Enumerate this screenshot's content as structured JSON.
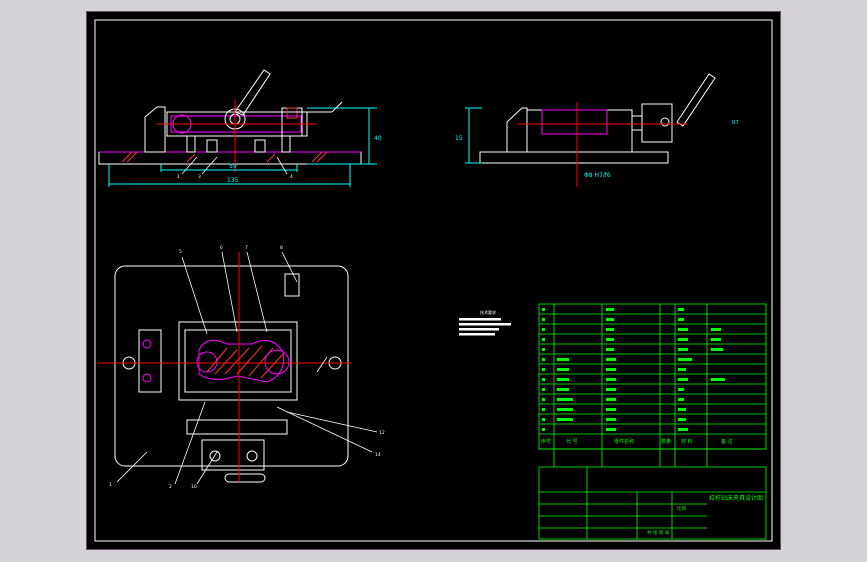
{
  "drawing": {
    "colors": {
      "background": "#000000",
      "frame": "#ffffff",
      "outline": "#ffffff",
      "part_outline": "#ff00ff",
      "centerline": "#ff0000",
      "dimension": "#00ffff",
      "hatch": "#ff3333",
      "table": "#00ff00",
      "leader": "#ffffff"
    },
    "dimensions": {
      "front_height": "40",
      "front_width_inner": "59",
      "front_width_outer": "135",
      "side_height": "15",
      "side_fit": "Φ8 H7/f6",
      "right_label": "R7"
    },
    "balloons": [
      "1",
      "2",
      "3",
      "4",
      "5",
      "6",
      "7",
      "8",
      "9",
      "10",
      "11",
      "12",
      "13",
      "14"
    ],
    "title_block": {
      "header_seq": "序号",
      "header_code": "代 号",
      "header_name": "零件名称",
      "header_qty": "数量",
      "header_material": "材 料",
      "header_remark": "备 注",
      "drawing_title": "杠杆钻床夹具设计图",
      "scale_label": "比例",
      "sheet_label": "共 张 第 张"
    },
    "tech_notes": "技术要求"
  }
}
